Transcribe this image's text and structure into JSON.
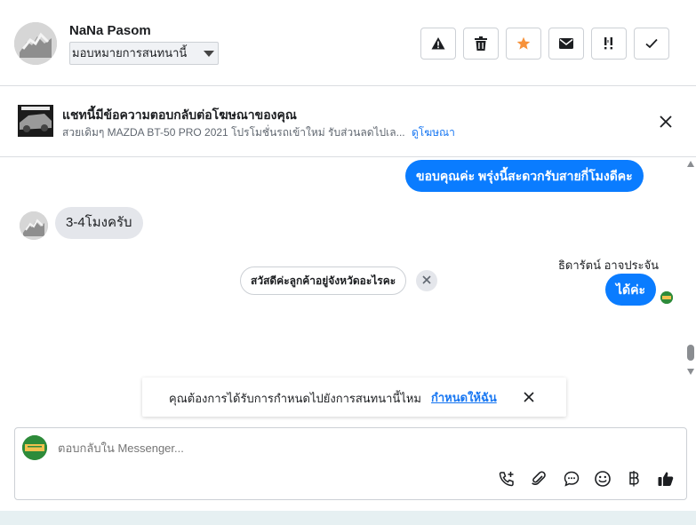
{
  "header": {
    "contact_name": "NaNa Pasom",
    "assign_label": "มอบหมายการสนทนานี้",
    "tools": [
      "spam-icon",
      "trash-icon",
      "star-icon",
      "mark-unread-icon",
      "follow-up-icon",
      "done-check-icon"
    ],
    "star_color": "#f7923b"
  },
  "ad_banner": {
    "title": "แชทนี้มีข้อความตอบกลับต่อโฆษณาของคุณ",
    "text": "สวยเดิมๆ MAZDA BT-50 PRO 2021 โปรโมชั่นรถเข้าใหม่ รับส่วนลดไปเล...",
    "link": "ดูโฆษณา"
  },
  "messages": [
    {
      "direction": "outgoing",
      "text": "ขอบคุณค่ะ พรุ่งนี้สะดวกรับสายกี่โมงดีคะ"
    },
    {
      "direction": "incoming",
      "text": "3-4โมงครับ"
    },
    {
      "direction": "outgoing",
      "sender": "ธิดารัตน์ อาจประจัน",
      "text": "ได้ค่ะ"
    }
  ],
  "quick_reply": "สวัสดีค่ะลูกค้าอยู่จังหวัดอะไรคะ",
  "assign_toast": {
    "text": "คุณต้องการได้รับการกำหนดไปยังการสนทนานี้ไหม",
    "link": "กำหนดให้ฉัน"
  },
  "composer": {
    "placeholder": "ตอบกลับใน Messenger...",
    "icons": [
      "add-call-icon",
      "attachment-icon",
      "saved-reply-icon",
      "emoji-icon",
      "baht-payment-icon",
      "like-icon"
    ]
  },
  "colors": {
    "accent": "#0a7cff",
    "link": "#1877f2",
    "bubble_in": "#e4e6eb"
  }
}
